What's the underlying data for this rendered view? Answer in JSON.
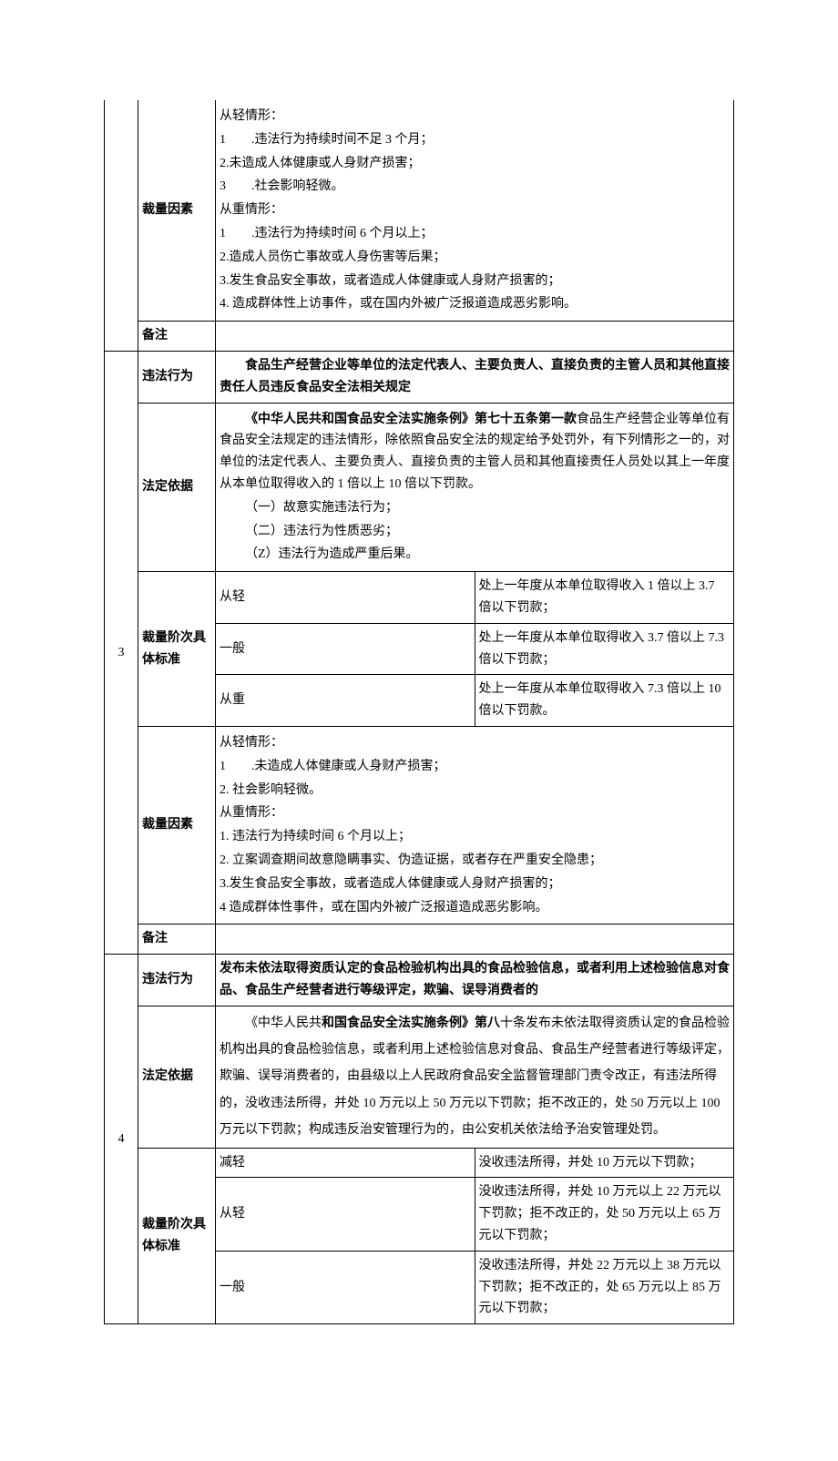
{
  "section_prev": {
    "factors_label": "裁量因素",
    "factors_content": [
      "从轻情形：",
      "1　　.违法行为持续时间不足 3 个月；",
      "2.未造成人体健康或人身财产损害；",
      "3　　.社会影响轻微。",
      "从重情形：",
      "1　　.违法行为持续时间 6 个月以上；",
      "2.造成人员伤亡事故或人身伤害等后果；",
      "3.发生食品安全事故，或者造成人体健康或人身财产损害的；",
      "4. 造成群体性上访事件，或在国内外被广泛报道造成恶劣影响。"
    ],
    "remark_label": "备注",
    "remark_content": ""
  },
  "section3": {
    "num": "3",
    "violation_label": "违法行为",
    "violation_content": "食品生产经营企业等单位的法定代表人、主要负责人、直接负责的主管人员和其他直接责任人员违反食品安全法相关规定",
    "basis_label": "法定依据",
    "basis_content": [
      "《中华人民共和国食品安全法实施条例》第七十五条第一款食品生产经营企业等单位有食品安全法规定的违法情形，除依照食品安全法的规定给予处罚外，有下列情形之一的，对单位的法定代表人、主要负责人、直接负责的主管人员和其他直接责任人员处以其上一年度从本单位取得收入的 1 倍以上 10 倍以下罚款。",
      "（一）故意实施违法行为；",
      "（二）违法行为性质恶劣；",
      "（Z）违法行为造成严重后果。"
    ],
    "levels_label": "裁量阶次具体标准",
    "levels": [
      {
        "name": "从轻",
        "text": "处上一年度从本单位取得收入 1 倍以上 3.7 倍以下罚款；"
      },
      {
        "name": "一般",
        "text": "处上一年度从本单位取得收入 3.7 倍以上 7.3 倍以下罚款；"
      },
      {
        "name": "从重",
        "text": "处上一年度从本单位取得收入 7.3 倍以上 10 倍以下罚款。"
      }
    ],
    "factors_label": "裁量因素",
    "factors_content": [
      "从轻情形：",
      "1　　.未造成人体健康或人身财产损害；",
      "2. 社会影响轻微。",
      "从重情形：",
      "1. 违法行为持续时间 6 个月以上；",
      "2. 立案调查期间故意隐瞒事实、伪造证据，或者存在严重安全隐患；",
      "3.发生食品安全事故，或者造成人体健康或人身财产损害的；",
      "4 造成群体性事件，或在国内外被广泛报道造成恶劣影响。"
    ],
    "remark_label": "备注",
    "remark_content": ""
  },
  "section4": {
    "num": "4",
    "violation_label": "违法行为",
    "violation_content": "发布未依法取得资质认定的食品检验机构出具的食品检验信息，或者利用上述检验信息对食品、食品生产经营者进行等级评定，欺骗、误导消费者的",
    "basis_label": "法定依据",
    "basis_content": "《中华人民共和国食品安全法实施条例》第八十条发布未依法取得资质认定的食品检验机构出具的食品检验信息，或者利用上述检验信息对食品、食品生产经营者进行等级评定，欺骗、误导消费者的，由县级以上人民政府食品安全监督管理部门责令改正，有违法所得的，没收违法所得，并处 10 万元以上 50 万元以下罚款；拒不改正的，处 50 万元以上 100 万元以下罚款；构成违反治安管理行为的，由公安机关依法给予治安管理处罚。",
    "levels_label": "裁量阶次具体标准",
    "levels": [
      {
        "name": "减轻",
        "text": "没收违法所得，并处 10 万元以下罚款；"
      },
      {
        "name": "从轻",
        "text": "没收违法所得，并处 10 万元以上 22 万元以下罚款；拒不改正的，处 50 万元以上 65 万元以下罚款；"
      },
      {
        "name": "一般",
        "text": "没收违法所得，并处 22 万元以上 38 万元以下罚款；拒不改正的，处 65 万元以上 85 万元以下罚款；"
      }
    ]
  }
}
